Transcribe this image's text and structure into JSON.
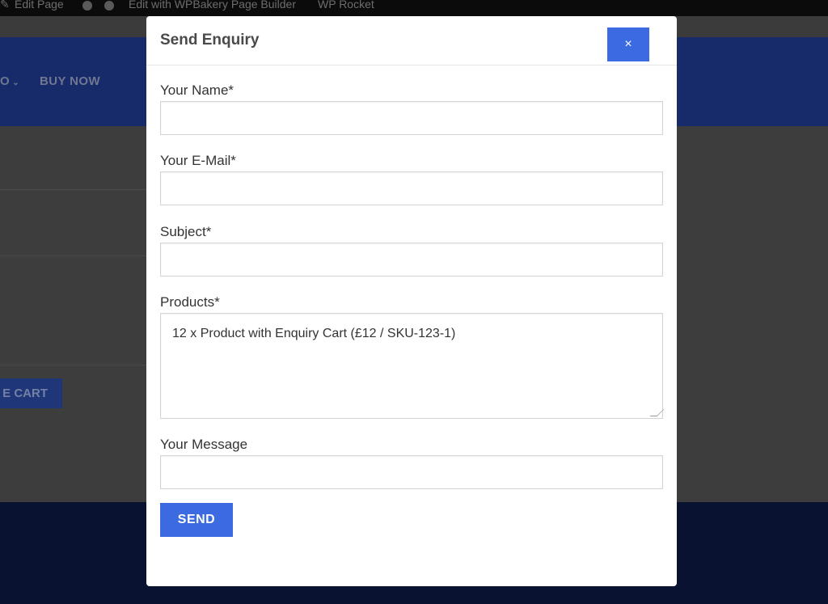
{
  "adminbar": {
    "edit_page": "Edit Page",
    "edit_wpbakery": "Edit with WPBakery Page Builder",
    "wp_rocket": "WP Rocket"
  },
  "nav": {
    "partial_item": "O",
    "buy_now": "BUY NOW"
  },
  "cart_button_partial": "E CART",
  "modal": {
    "title": "Send Enquiry",
    "close_label": "×",
    "fields": {
      "name_label": "Your Name*",
      "name_value": "",
      "email_label": "Your E-Mail*",
      "email_value": "",
      "subject_label": "Subject*",
      "subject_value": "",
      "products_label": "Products*",
      "products_value": "12 x Product with Enquiry Cart (£12 / SKU-123-1)",
      "message_label": "Your Message",
      "message_value": ""
    },
    "send_label": "SEND"
  },
  "colors": {
    "accent": "#3c6ae0",
    "nav_bg_dimmed": "#172a69",
    "footer_bg_dimmed": "#0a1232"
  }
}
